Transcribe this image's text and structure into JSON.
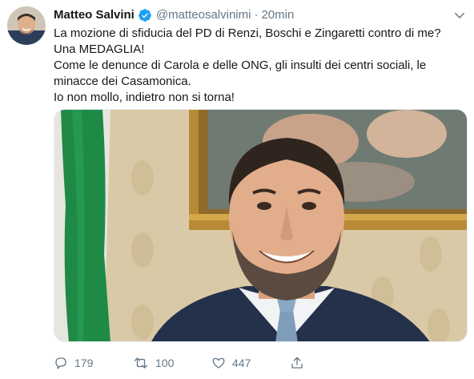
{
  "tweet": {
    "author": {
      "display_name": "Matteo Salvini",
      "handle": "@matteosalvinimi",
      "separator": "·",
      "timestamp": "20min",
      "verified": true
    },
    "text_lines": [
      "La mozione di sfiducia del PD di Renzi, Boschi e Zingaretti contro di me?",
      "Una MEDAGLIA!",
      "Come le denunce di Carola e delle ONG, gli insulti dei centri sociali, le",
      "minacce dei Casamonica.",
      "Io non mollo, indietro non si torna!"
    ],
    "actions": {
      "reply_count": "179",
      "retweet_count": "100",
      "like_count": "447"
    },
    "icons": {
      "verified": "verified-badge-icon",
      "caret": "chevron-down-icon",
      "reply": "reply-icon",
      "retweet": "retweet-icon",
      "like": "heart-icon",
      "share": "share-icon"
    }
  },
  "colors": {
    "text_primary": "#14171a",
    "text_secondary": "#657786",
    "verified_blue": "#1da1f2",
    "border": "#e6ecf0"
  }
}
